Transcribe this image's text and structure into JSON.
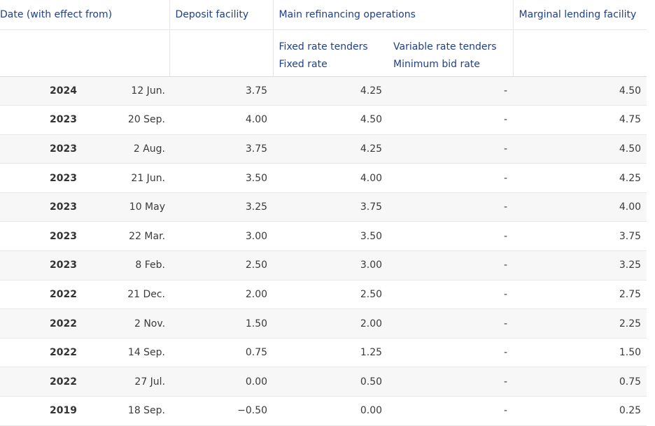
{
  "headers": {
    "date": "Date (with effect from)",
    "deposit": "Deposit facility",
    "mro": "Main refinancing operations",
    "mlf": "Marginal lending facility",
    "fixed_tenders": "Fixed rate tenders",
    "fixed_rate": "Fixed rate",
    "variable_tenders": "Variable rate tenders",
    "min_bid_rate": "Minimum bid rate"
  },
  "rows": [
    {
      "year": "2024",
      "date": "12 Jun.",
      "deposit": "3.75",
      "fixed": "4.25",
      "variable": "-",
      "mlf": "4.50"
    },
    {
      "year": "2023",
      "date": "20 Sep.",
      "deposit": "4.00",
      "fixed": "4.50",
      "variable": "-",
      "mlf": "4.75"
    },
    {
      "year": "2023",
      "date": "2 Aug.",
      "deposit": "3.75",
      "fixed": "4.25",
      "variable": "-",
      "mlf": "4.50"
    },
    {
      "year": "2023",
      "date": "21 Jun.",
      "deposit": "3.50",
      "fixed": "4.00",
      "variable": "-",
      "mlf": "4.25"
    },
    {
      "year": "2023",
      "date": "10 May",
      "deposit": "3.25",
      "fixed": "3.75",
      "variable": "-",
      "mlf": "4.00"
    },
    {
      "year": "2023",
      "date": "22 Mar.",
      "deposit": "3.00",
      "fixed": "3.50",
      "variable": "-",
      "mlf": "3.75"
    },
    {
      "year": "2023",
      "date": "8 Feb.",
      "deposit": "2.50",
      "fixed": "3.00",
      "variable": "-",
      "mlf": "3.25"
    },
    {
      "year": "2022",
      "date": "21 Dec.",
      "deposit": "2.00",
      "fixed": "2.50",
      "variable": "-",
      "mlf": "2.75"
    },
    {
      "year": "2022",
      "date": "2 Nov.",
      "deposit": "1.50",
      "fixed": "2.00",
      "variable": "-",
      "mlf": "2.25"
    },
    {
      "year": "2022",
      "date": "14 Sep.",
      "deposit": "0.75",
      "fixed": "1.25",
      "variable": "-",
      "mlf": "1.50"
    },
    {
      "year": "2022",
      "date": "27 Jul.",
      "deposit": "0.00",
      "fixed": "0.50",
      "variable": "-",
      "mlf": "0.75"
    },
    {
      "year": "2019",
      "date": "18 Sep.",
      "deposit": "−0.50",
      "fixed": "0.00",
      "variable": "-",
      "mlf": "0.25"
    }
  ]
}
